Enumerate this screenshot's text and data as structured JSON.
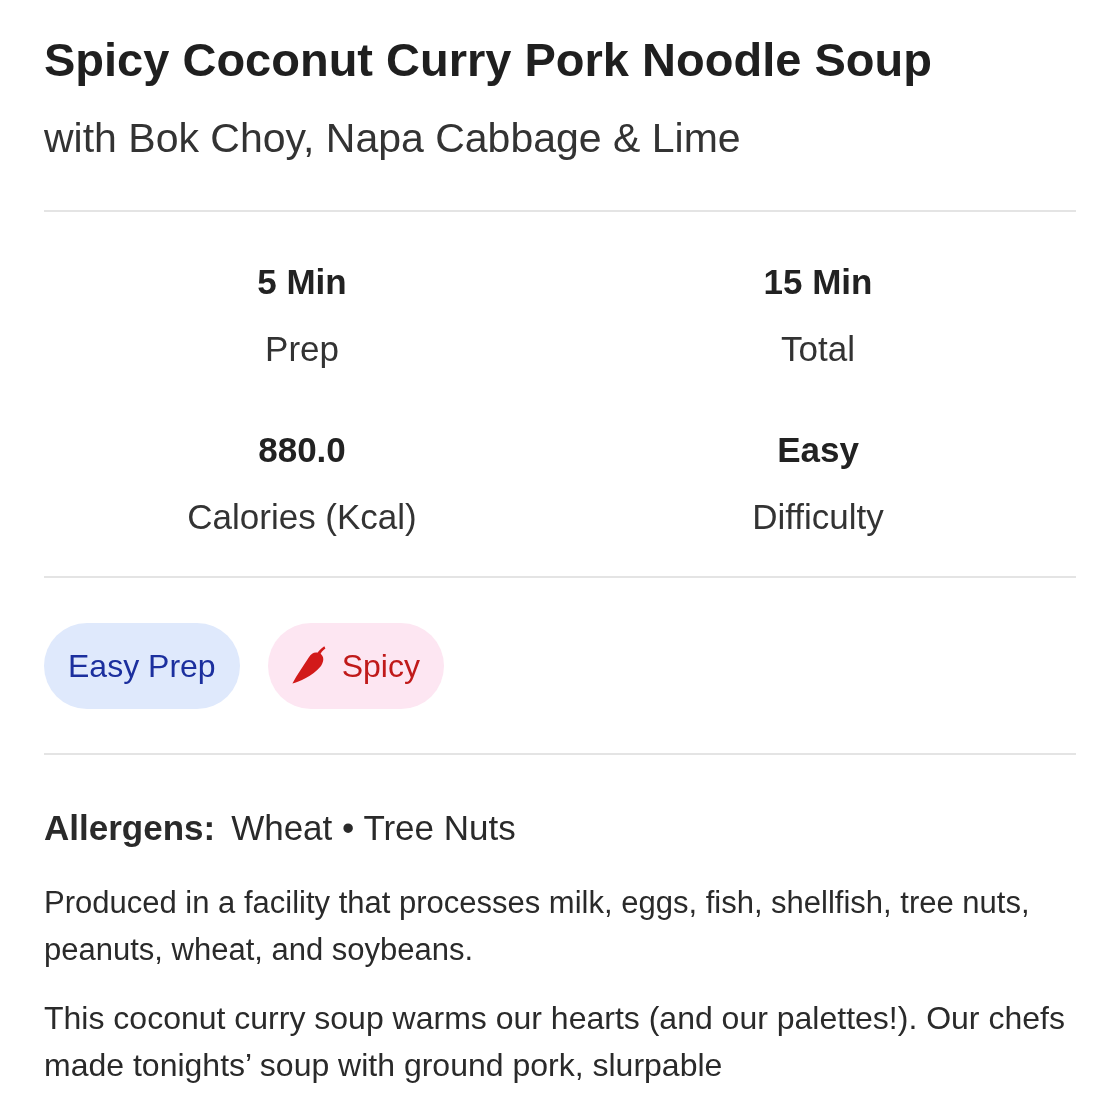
{
  "title": "Spicy Coconut Curry Pork Noodle Soup",
  "subtitle": "with Bok Choy, Napa Cabbage & Lime",
  "stats": [
    {
      "value": "5 Min",
      "label": "Prep"
    },
    {
      "value": "15 Min",
      "label": "Total"
    },
    {
      "value": "880.0",
      "label": "Calories (Kcal)"
    },
    {
      "value": "Easy",
      "label": "Difficulty"
    }
  ],
  "tags": [
    {
      "label": "Easy Prep",
      "kind": "easy"
    },
    {
      "label": "Spicy",
      "kind": "spicy"
    }
  ],
  "allergens": {
    "label": "Allergens:",
    "values": "Wheat • Tree Nuts"
  },
  "facility_note": "Produced in a facility that processes milk, eggs, fish, shellfish, tree nuts, peanuts, wheat, and soybeans.",
  "description": {
    "text": "This coconut curry soup warms our hearts (and our palettes!). Our chefs made tonights’ soup with ground pork, slurpable"
  }
}
